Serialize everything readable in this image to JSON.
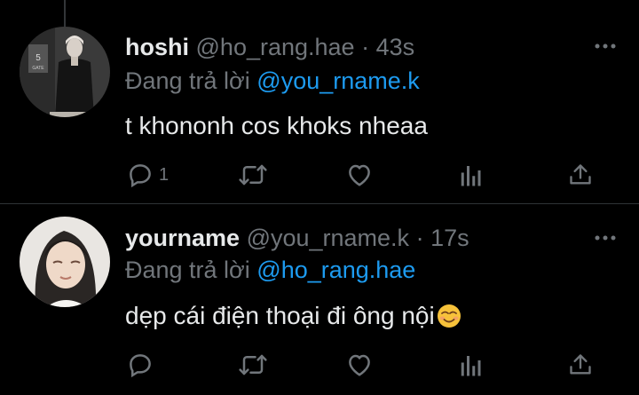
{
  "tweets": [
    {
      "display_name": "hoshi",
      "handle": "@ho_rang.hae",
      "separator": "·",
      "time": "43s",
      "reply_prefix": "Đang trả lời",
      "reply_mention": "@you_rname.k",
      "text": "t khononh cos khoks nheaa",
      "reply_count": "1",
      "avatar_label": "5",
      "avatar_sub": "GATE"
    },
    {
      "display_name": "yourname",
      "handle": "@you_rname.k",
      "separator": "·",
      "time": "17s",
      "reply_prefix": "Đang trả lời",
      "reply_mention": "@ho_rang.hae",
      "text": "dẹp cái điện thoại đi ông nội",
      "reply_count": ""
    }
  ],
  "icons": [
    "reply-icon",
    "retweet-icon",
    "like-icon",
    "analytics-icon",
    "share-icon",
    "more-icon",
    "smiling-face-emoji"
  ],
  "colors": {
    "background": "#000000",
    "primary_text": "#e7e9ea",
    "secondary_text": "#71767b",
    "link": "#1d9bf0",
    "divider": "#2f3336"
  }
}
